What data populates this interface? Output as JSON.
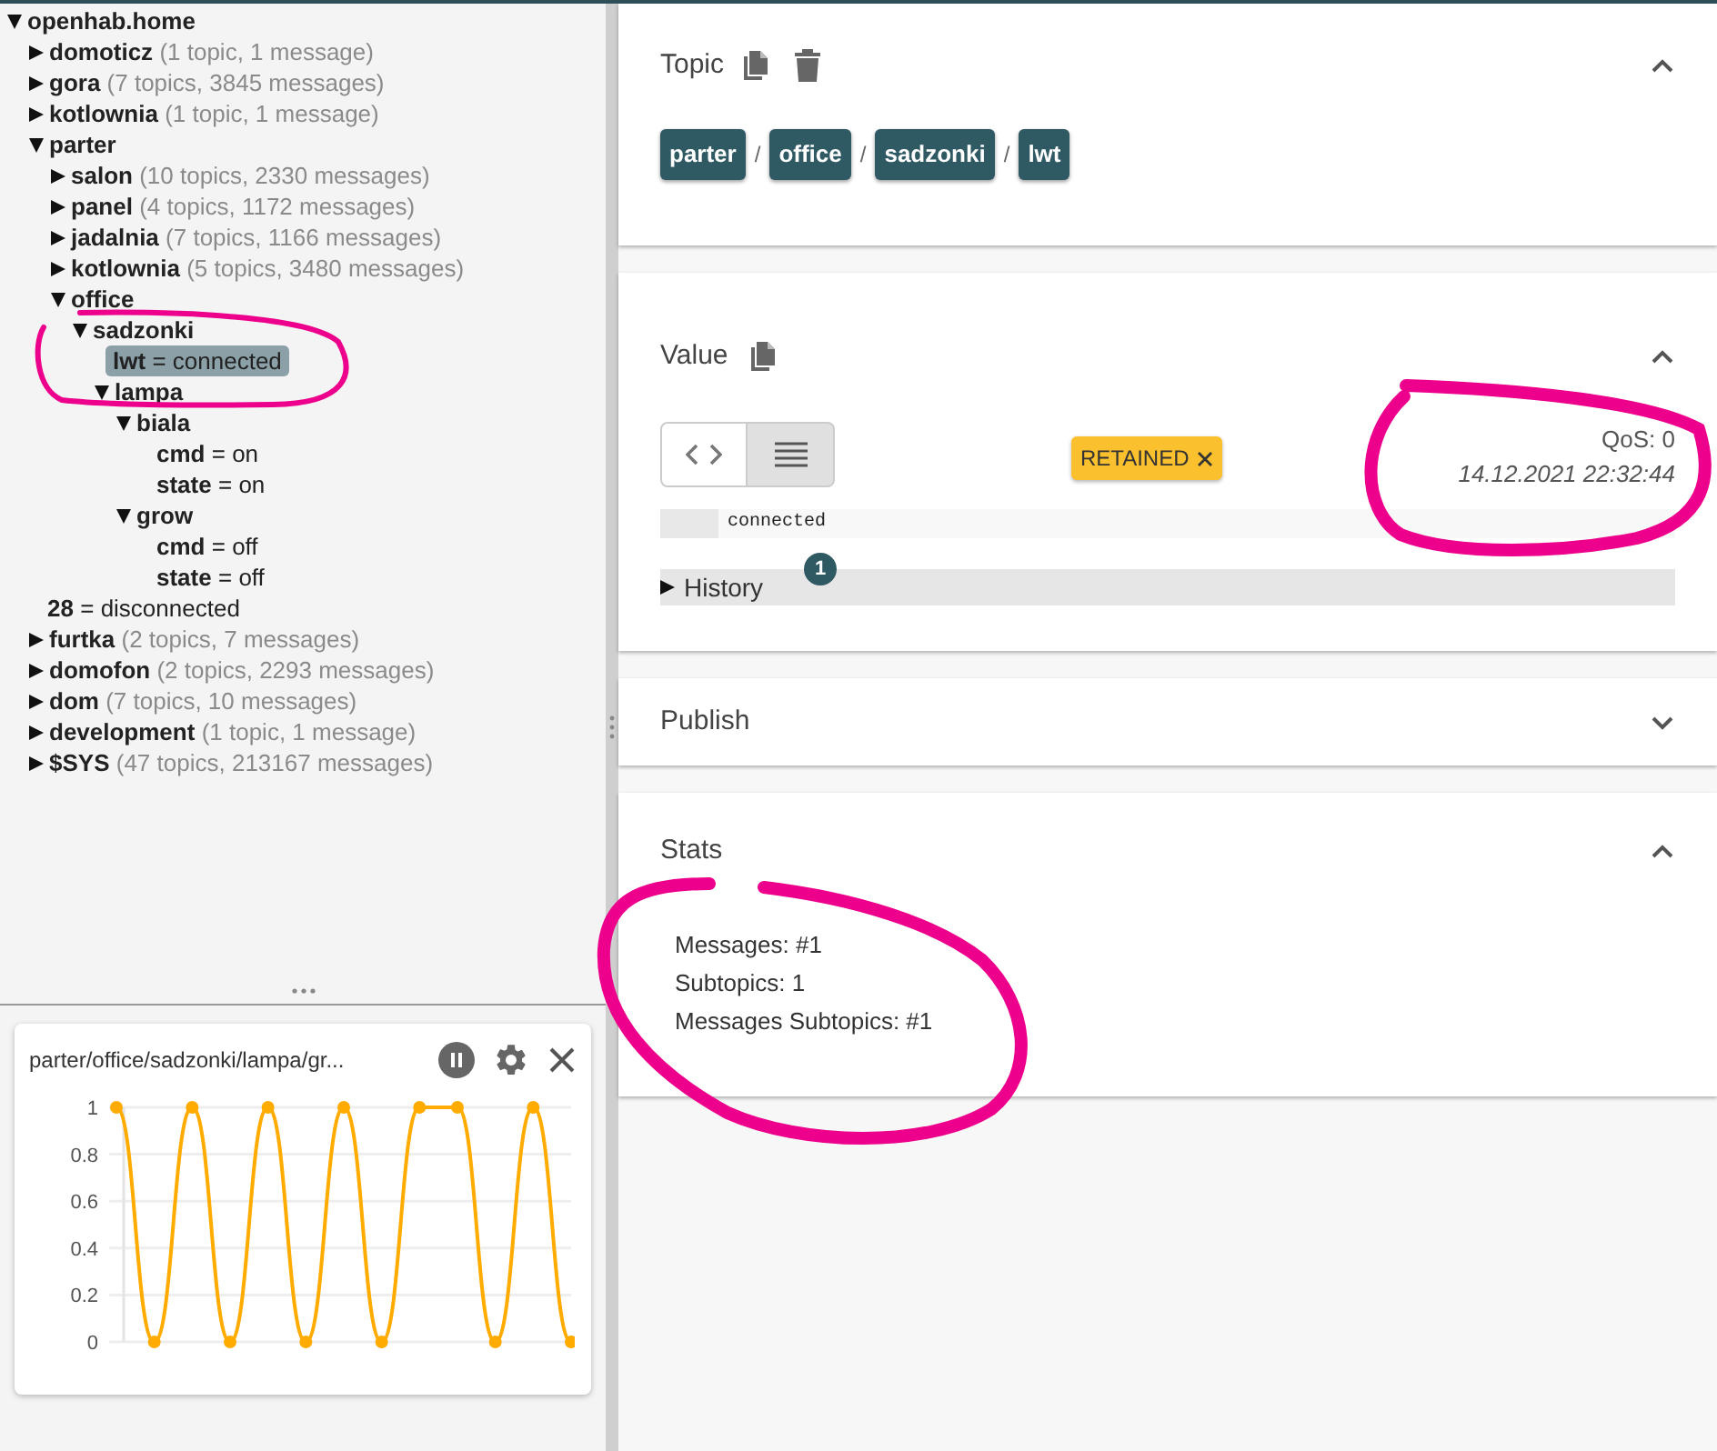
{
  "tree": {
    "name": "openhab.home",
    "expanded": true,
    "selected": false,
    "children": [
      {
        "name": "domoticz",
        "summary": "(1 topic, 1 message)",
        "expanded": false,
        "selected": false
      },
      {
        "name": "gora",
        "summary": "(7 topics, 3845 messages)",
        "expanded": false,
        "selected": false
      },
      {
        "name": "kotlownia",
        "summary": "(1 topic, 1 message)",
        "expanded": false,
        "selected": false
      },
      {
        "name": "parter",
        "expanded": true,
        "selected": false,
        "children": [
          {
            "name": "salon",
            "summary": "(10 topics, 2330 messages)",
            "expanded": false,
            "selected": false
          },
          {
            "name": "panel",
            "summary": "(4 topics, 1172 messages)",
            "expanded": false,
            "selected": false
          },
          {
            "name": "jadalnia",
            "summary": "(7 topics, 1166 messages)",
            "expanded": false,
            "selected": false
          },
          {
            "name": "kotlownia",
            "summary": "(5 topics, 3480 messages)",
            "expanded": false,
            "selected": false
          },
          {
            "name": "office",
            "expanded": true,
            "selected": false,
            "children": [
              {
                "name": "sadzonki",
                "expanded": true,
                "selected": false,
                "children": [
                  {
                    "name": "lwt",
                    "separator": "=",
                    "value": "connected",
                    "selected": true
                  },
                  {
                    "name": "lampa",
                    "expanded": true,
                    "selected": false,
                    "children": [
                      {
                        "name": "biala",
                        "expanded": true,
                        "selected": false,
                        "children": [
                          {
                            "name": "cmd",
                            "separator": "=",
                            "value": "on",
                            "selected": false
                          },
                          {
                            "name": "state",
                            "separator": "=",
                            "value": "on",
                            "selected": false
                          }
                        ]
                      },
                      {
                        "name": "grow",
                        "expanded": true,
                        "selected": false,
                        "children": [
                          {
                            "name": "cmd",
                            "separator": "=",
                            "value": "off",
                            "selected": false
                          },
                          {
                            "name": "state",
                            "separator": "=",
                            "value": "off",
                            "selected": false
                          }
                        ]
                      }
                    ]
                  }
                ]
              }
            ]
          }
        ]
      },
      {
        "name": "28",
        "separator": "=",
        "value": "disconnected",
        "selected": false
      },
      {
        "name": "furtka",
        "summary": "(2 topics, 7 messages)",
        "expanded": false,
        "selected": false
      },
      {
        "name": "domofon",
        "summary": "(2 topics, 2293 messages)",
        "expanded": false,
        "selected": false
      },
      {
        "name": "dom",
        "summary": "(7 topics, 10 messages)",
        "expanded": false,
        "selected": false
      },
      {
        "name": "development",
        "summary": "(1 topic, 1 message)",
        "expanded": false,
        "selected": false
      },
      {
        "name": "$SYS",
        "summary": "(47 topics, 213167 messages)",
        "expanded": false,
        "selected": false
      }
    ]
  },
  "chart_panel": {
    "title": "parter/office/sadzonki/lampa/gr...",
    "paused": true,
    "chart_data": {
      "type": "line",
      "grid": true,
      "ylim": [
        0,
        1
      ],
      "yticks": [
        {
          "value": 0,
          "label": "0"
        },
        {
          "value": 0.2,
          "label": "0.2"
        },
        {
          "value": 0.4,
          "label": "0.4"
        },
        {
          "value": 0.6,
          "label": "0.6"
        },
        {
          "value": 0.8,
          "label": "0.8"
        },
        {
          "value": 1,
          "label": "1"
        }
      ],
      "series": [
        {
          "marker": true,
          "color": "#ffab00",
          "values": [
            1,
            0,
            1,
            0,
            1,
            0,
            1,
            0,
            1,
            1,
            0,
            1,
            0
          ]
        }
      ]
    }
  },
  "topic_section": {
    "title": "Topic",
    "expanded": true,
    "segments": [
      {
        "kind": "chip",
        "label": "parter"
      },
      {
        "kind": "separator",
        "label": "/"
      },
      {
        "kind": "chip",
        "label": "office"
      },
      {
        "kind": "separator",
        "label": "/"
      },
      {
        "kind": "chip",
        "label": "sadzonki"
      },
      {
        "kind": "separator",
        "label": "/"
      },
      {
        "kind": "chip",
        "label": "lwt"
      }
    ]
  },
  "value_section": {
    "title": "Value",
    "expanded": true,
    "view_modes": [
      {
        "kind": "code",
        "selected": false
      },
      {
        "kind": "raw",
        "selected": true
      }
    ],
    "retained_label": "RETAINED",
    "qos": "QoS: 0",
    "timestamp": "14.12.2021 22:32:44",
    "payload": "connected",
    "history": {
      "label": "History",
      "count": "1",
      "expanded": false
    }
  },
  "publish_section": {
    "title": "Publish",
    "expanded": false
  },
  "stats_section": {
    "title": "Stats",
    "expanded": true,
    "lines": [
      "Messages: #1",
      "Subtopics: 1",
      "Messages Subtopics: #1"
    ]
  }
}
